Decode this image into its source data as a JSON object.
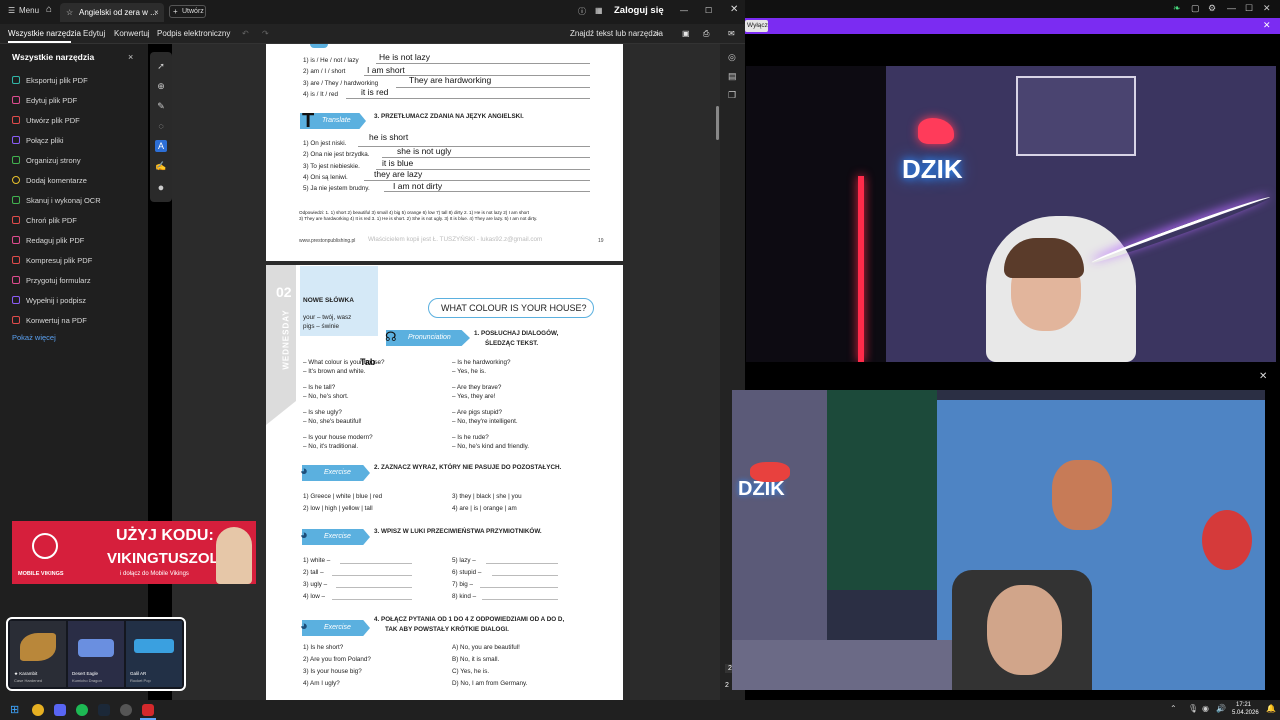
{
  "titlebar": {
    "menu_label": "Menu",
    "tab_title": "Angielski od zera w ...",
    "new_tab_label": "Utwórz",
    "sign_in": "Zaloguj się"
  },
  "menubar": {
    "items": [
      "Wszystkie narzędzia",
      "Edytuj",
      "Konwertuj",
      "Podpis elektroniczny"
    ],
    "find_label": "Znajdź tekst lub narzędzia"
  },
  "sidebar": {
    "title": "Wszystkie narzędzia",
    "items": [
      {
        "label": "Eksportuj plik PDF",
        "color": "#2fb7a8"
      },
      {
        "label": "Edytuj plik PDF",
        "color": "#e04b8f"
      },
      {
        "label": "Utwórz plik PDF",
        "color": "#e04b4b"
      },
      {
        "label": "Połącz pliki",
        "color": "#8b5cf6"
      },
      {
        "label": "Organizuj strony",
        "color": "#40b34f"
      },
      {
        "label": "Dodaj komentarze",
        "color": "#e8c12b"
      },
      {
        "label": "Skanuj i wykonaj OCR",
        "color": "#40b34f"
      },
      {
        "label": "Chroń plik PDF",
        "color": "#e04b4b"
      },
      {
        "label": "Redaguj plik PDF",
        "color": "#e04b8f"
      },
      {
        "label": "Kompresuj plik PDF",
        "color": "#e04b4b"
      },
      {
        "label": "Przygotuj formularz",
        "color": "#e04b8f"
      },
      {
        "label": "Wypełnij i podpisz",
        "color": "#8b5cf6"
      },
      {
        "label": "Konwertuj na PDF",
        "color": "#e04b4b"
      }
    ],
    "show_more": "Pokaż więcej"
  },
  "page1": {
    "prompts": [
      "1) is / He / not / lazy",
      "2) am / I / short",
      "3) are / They / hardworking",
      "4) is / It / red"
    ],
    "answers": [
      "He is not lazy",
      "I am short",
      "They are hardworking",
      "it is red"
    ],
    "translate_banner": "Translate",
    "translate_heading": "3.  PRZETŁUMACZ ZDANIA NA JĘZYK ANGIELSKI.",
    "t_prompts": [
      "1) On jest niski.",
      "2) Ona nie jest brzydka.",
      "3) To jest niebieskie.",
      "4) Oni są leniwi.",
      "5) Ja nie jestem brudny."
    ],
    "t_answers": [
      "he is short",
      "she is not ugly",
      "it is blue",
      "they are lazy",
      "I am not dirty"
    ],
    "key1": "Odpowiedzi: 1. 1) short 2) beautiful 3) small 4) big 5) orange 6) low 7) tall 8) dirty 2. 1) He is not lazy 2) I am short",
    "key2": "3) They are hardworking 4) It is red 3. 1) He is short. 2) She is not ugly. 3) It is blue. 4) They are lazy. 5) I am not dirty.",
    "footer_site": "www.prestonpublishing.pl",
    "footer_owner": "Właścicielem kopii jest Ł. TUSZYŃSKI - lukas92.z@gmail.com",
    "page_num": "19"
  },
  "page2": {
    "day": "WEDNESDAY",
    "day_num": "02",
    "vocab_title": "NOWE SŁÓWKA",
    "vocab1": "your – twój, wasz",
    "vocab2": "pigs – świnie",
    "title": "WHAT COLOUR IS YOUR HOUSE?",
    "pron_banner": "Pronunciation",
    "pron_heading1": "1.  POSŁUCHAJ DIALOGÓW,",
    "pron_heading2": "ŚLEDZĄC TEKST.",
    "dialog_left": [
      "– What colour is your house?",
      "– It's brown and white.",
      "– Is he tall?",
      "– No, he's short.",
      "– Is she ugly?",
      "– No, she's beautiful!",
      "– Is your house modern?",
      "– No, it's traditional."
    ],
    "dialog_right": [
      "– Is he hardworking?",
      "– Yes, he is.",
      "– Are they brave?",
      "– Yes, they are!",
      "– Are pigs stupid?",
      "– No, they're intelligent.",
      "– Is he rude?",
      "– No, he's kind and friendly."
    ],
    "ex_banner": "Exercise",
    "ex2_heading": "2.  ZAZNACZ WYRAZ, KTÓRY NIE PASUJE DO POZOSTAŁYCH.",
    "ex2_left": [
      "1)  Greece | white | blue | red",
      "2)  low | high | yellow | tall"
    ],
    "ex2_right": [
      "3)  they | black | she | you",
      "4)  are | is | orange | am"
    ],
    "ex3_heading": "3.  WPISZ W LUKI PRZECIWIEŃSTWA PRZYMIOTNIKÓW.",
    "ex3_left": [
      "1)  white –",
      "2)  tall –",
      "3)  ugly –",
      "4)  low –"
    ],
    "ex3_right": [
      "5)  lazy –",
      "6)  stupid –",
      "7)  big –",
      "8)  kind –"
    ],
    "ex4_heading1": "4.  POŁĄCZ PYTANIA OD 1 DO 4 Z ODPOWIEDZIAMI OD A DO D,",
    "ex4_heading2": "TAK ABY POWSTAŁY KRÓTKIE DIALOGI.",
    "ex4_left": [
      "1)  Is he short?",
      "2)  Are you from Poland?",
      "3)  Is your house big?",
      "4)  Am I ugly?"
    ],
    "ex4_right": [
      "A)  No, you are beautiful!",
      "B)  No, it is small.",
      "C)  Yes, he is.",
      "D)  No, I am from Germany."
    ],
    "cursor_text": "Tab"
  },
  "stream": {
    "button": "Wyłącz",
    "neon1": "DZIK",
    "neon2": "DZIK"
  },
  "ad": {
    "line1": "UŻYJ KODU:",
    "line2": "VIKINGTUSZOL",
    "line3": "i dołącz do Mobile Vikings",
    "brand": "MOBILE VIKINGS"
  },
  "skins": [
    {
      "name": "★ Karambit",
      "sub": "Case Hardened"
    },
    {
      "name": "Desert Eagle",
      "sub": "Kumicho Dragon"
    },
    {
      "name": "Galil AR",
      "sub": "Rocket Pop"
    }
  ],
  "page_counter": [
    "2",
    "2"
  ],
  "taskbar": {
    "time": "17:21",
    "date": "5.04.2026"
  }
}
